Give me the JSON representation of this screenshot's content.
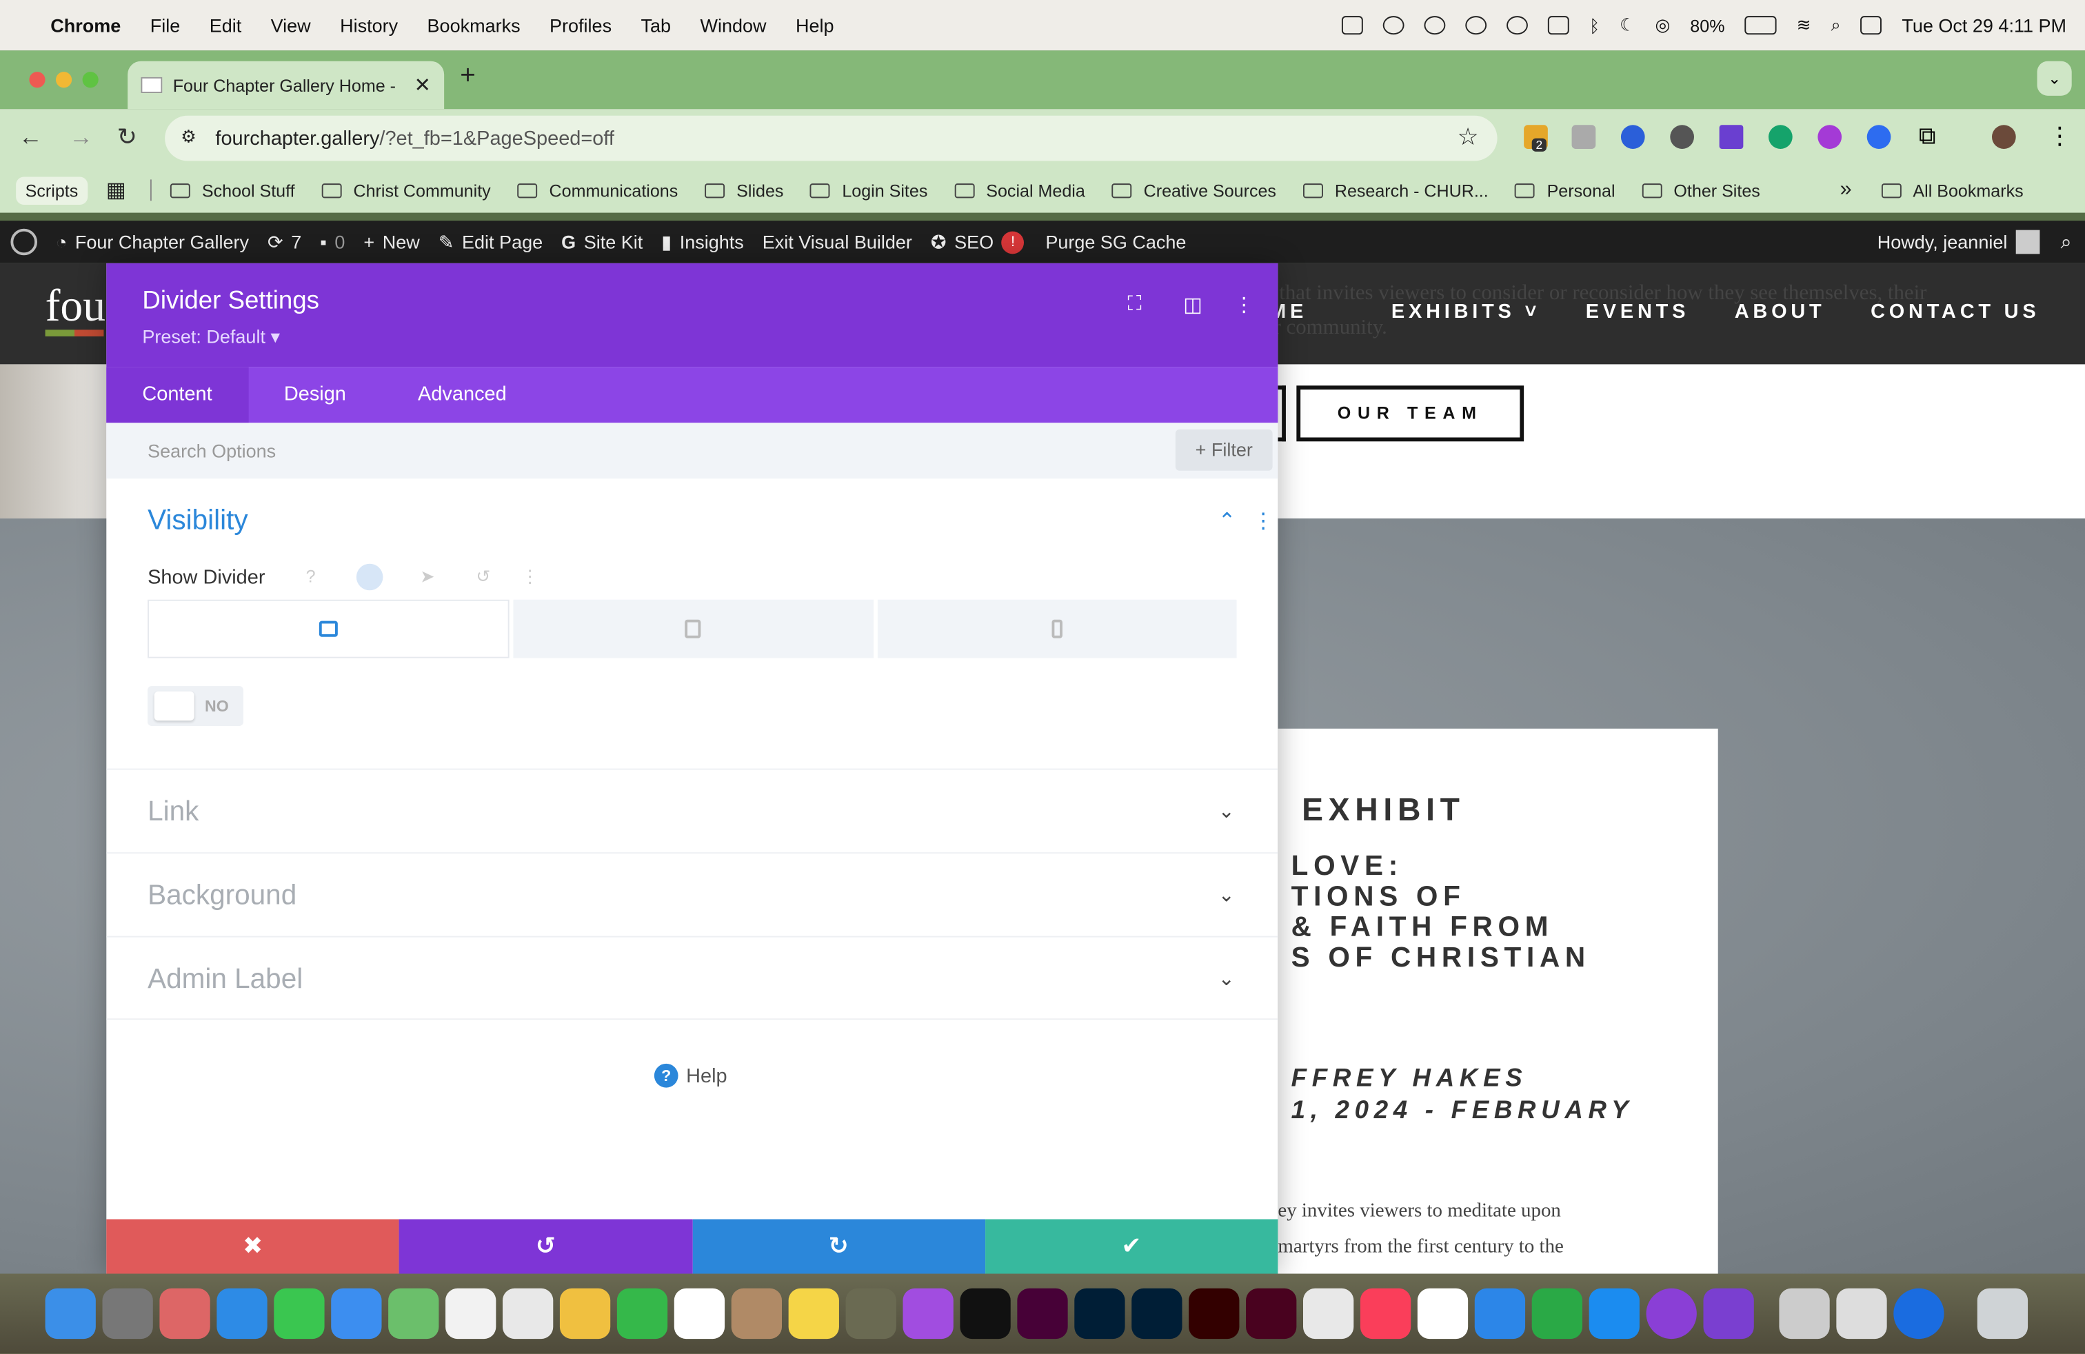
{
  "menubar": {
    "app": "Chrome",
    "items": [
      "File",
      "Edit",
      "View",
      "History",
      "Bookmarks",
      "Profiles",
      "Tab",
      "Window",
      "Help"
    ],
    "battery": "80%",
    "datetime": "Tue Oct 29  4:11 PM"
  },
  "tab": {
    "title": "Four Chapter Gallery Home -"
  },
  "address": {
    "domain": "fourchapter.gallery",
    "path": "/?et_fb=1&PageSpeed=off",
    "ext_badge": "2"
  },
  "bookmarks": {
    "scripts": "Scripts",
    "items": [
      "School Stuff",
      "Christ Community",
      "Communications",
      "Slides",
      "Login Sites",
      "Social Media",
      "Creative Sources",
      "Research - CHUR...",
      "Personal",
      "Other Sites"
    ],
    "more": "»",
    "all": "All Bookmarks"
  },
  "wpbar": {
    "site": "Four Chapter Gallery",
    "updates": "7",
    "comments": "0",
    "new": "New",
    "edit": "Edit Page",
    "sitekit": "Site Kit",
    "insights": "Insights",
    "exit": "Exit Visual Builder",
    "seo": "SEO",
    "seo_badge": "!",
    "purge": "Purge SG Cache",
    "howdy": "Howdy, jeanniel"
  },
  "site": {
    "logo": "fou",
    "nav_home": "OME",
    "nav": [
      "EXHIBITS ˅",
      "EVENTS",
      "ABOUT",
      "CONTACT US"
    ],
    "bg_text": "k that invites viewers to consider or reconsider how they see themselves, their\nur community.",
    "team_button": "OUR TEAM",
    "exhibit_label": "EXHIBIT",
    "exhibit_title": "LOVE:\nTIONS OF\n& FAITH FROM\nS OF CHRISTIAN",
    "exhibit_meta": "FFREY HAKES\n1, 2024 - FEBRUARY",
    "exhibit_body": "ey invites viewers to meditate upon\nmartyrs from the first century to the"
  },
  "modal": {
    "title": "Divider Settings",
    "preset": "Preset: Default ▾",
    "tabs": [
      "Content",
      "Design",
      "Advanced"
    ],
    "search_placeholder": "Search Options",
    "filter": "+ Filter",
    "visibility": "Visibility",
    "show_divider": "Show Divider",
    "toggle": "NO",
    "sections": [
      "Link",
      "Background",
      "Admin Label"
    ],
    "help": "Help"
  },
  "footer": {
    "cancel": "✖",
    "undo": "↺",
    "redo": "↻",
    "save": "✔"
  },
  "colors": {
    "purple_header": "#7e35d6",
    "purple_tabs": "#8c45e6",
    "blue": "#2b87da",
    "cancel": "#e05a5a",
    "undo": "#7e35d6",
    "redo": "#2b87da",
    "save": "#37b99e"
  }
}
